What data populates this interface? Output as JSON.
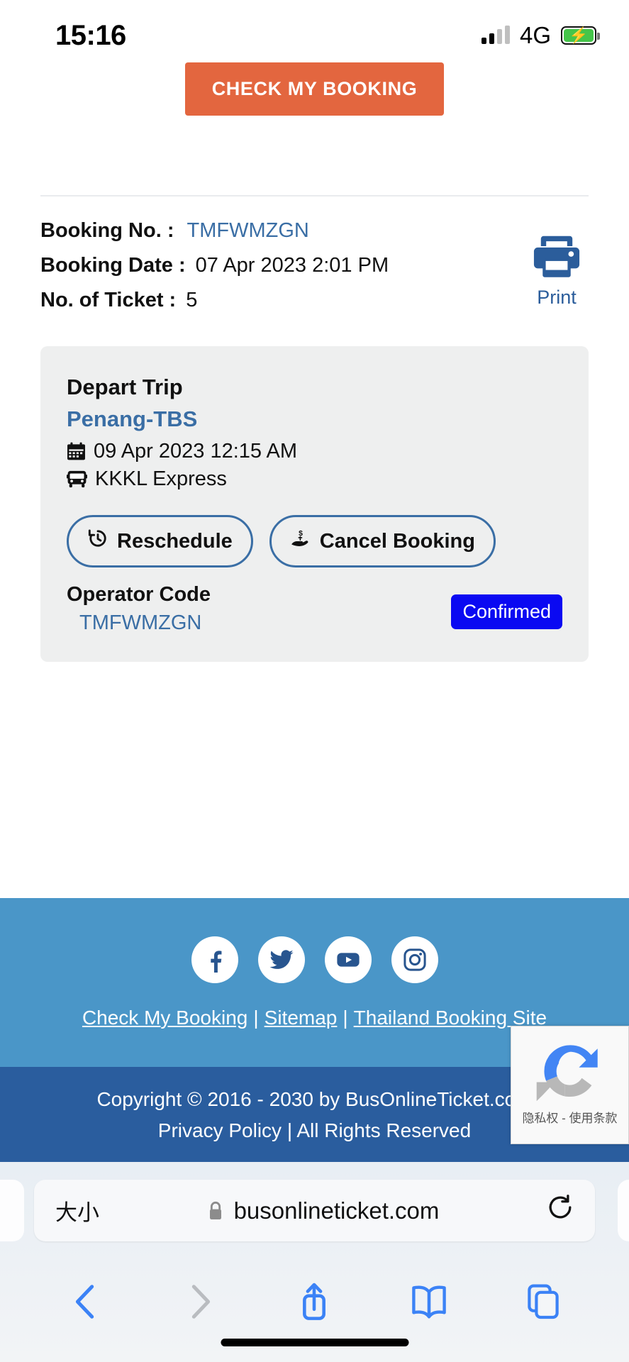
{
  "status_bar": {
    "time": "15:16",
    "network": "4G",
    "signal_icon": "signal-bars-icon",
    "battery_icon": "battery-charging-icon"
  },
  "cta": {
    "label": "CHECK MY BOOKING",
    "color": "#e3663f"
  },
  "booking": {
    "rows": [
      {
        "label": "Booking No. :",
        "value": "TMFWMZGN",
        "is_link": true
      },
      {
        "label": "Booking Date :",
        "value": "07 Apr 2023 2:01 PM",
        "is_link": false
      },
      {
        "label": "No. of Ticket :",
        "value": "5",
        "is_link": false
      }
    ],
    "print": {
      "label": "Print",
      "icon": "printer-icon",
      "color": "#2b5d9b"
    }
  },
  "trip": {
    "title": "Depart Trip",
    "route": "Penang-TBS",
    "datetime": "09 Apr 2023 12:15 AM",
    "operator": "KKKL Express",
    "calendar_icon": "calendar-icon",
    "bus_icon": "bus-icon",
    "buttons": [
      {
        "label": "Reschedule",
        "icon": "clock-rewind-icon"
      },
      {
        "label": "Cancel Booking",
        "icon": "hand-money-icon"
      }
    ],
    "operator_code_title": "Operator Code",
    "operator_code": "TMFWMZGN",
    "status": "Confirmed",
    "status_color": "#0a09f2",
    "card_bg": "#eeefef"
  },
  "footer": {
    "bg_top": "#4a96c8",
    "bg_bottom": "#2a5d9e",
    "socials": [
      {
        "name": "facebook-icon"
      },
      {
        "name": "twitter-icon"
      },
      {
        "name": "youtube-icon"
      },
      {
        "name": "instagram-icon"
      }
    ],
    "links": [
      {
        "label": "Check My Booking"
      },
      {
        "label": "Sitemap"
      },
      {
        "label": "Thailand Booking Site"
      }
    ],
    "separator": "|",
    "copyright": "Copyright © 2016 - 2030 by  BusOnlineTicket.com",
    "copyright_line2": "Privacy Policy | All Rights Reserved"
  },
  "recaptcha": {
    "text": "隐私权 - 使用条款",
    "icon": "recaptcha-icon"
  },
  "browser": {
    "text_size_label": "大小",
    "lock_icon": "lock-icon",
    "url": "busonlineticket.com",
    "reload_icon": "reload-icon",
    "toolbar": [
      {
        "name": "back-button",
        "icon": "chevron-left-icon",
        "enabled": true
      },
      {
        "name": "forward-button",
        "icon": "chevron-right-icon",
        "enabled": false
      },
      {
        "name": "share-button",
        "icon": "share-icon",
        "enabled": true
      },
      {
        "name": "bookmarks-button",
        "icon": "book-icon",
        "enabled": true
      },
      {
        "name": "tabs-button",
        "icon": "tabs-icon",
        "enabled": true
      }
    ]
  }
}
